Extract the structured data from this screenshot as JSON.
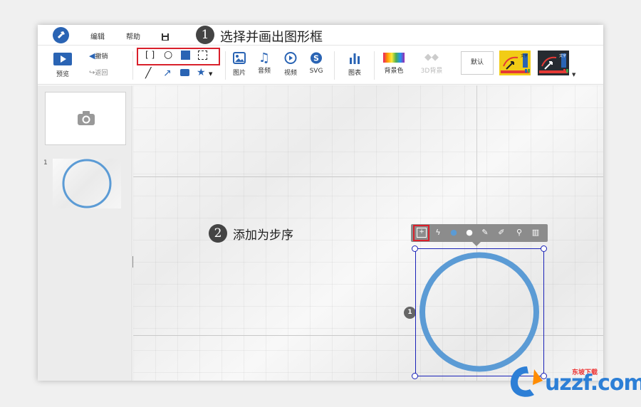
{
  "menubar": {
    "edit": "编辑",
    "help": "帮助"
  },
  "annotations": {
    "step1_num": "1",
    "step1_text": "选择并画出图形框",
    "step2_num": "2",
    "step2_text": "添加为步序"
  },
  "toolbar": {
    "preview": "预览",
    "undo": "撤销",
    "redo": "返回",
    "image": "图片",
    "audio": "音频",
    "video": "视频",
    "svg": "SVG",
    "chart": "图表",
    "background": "背景色",
    "bg3d": "3D背景",
    "default": "默认",
    "theme_text": "文字"
  },
  "slides": {
    "number": "1"
  },
  "canvas": {
    "step_marker": "1"
  },
  "watermark": {
    "brand": "uzzf.com",
    "sub": "东坡下载"
  },
  "colors": {
    "accent_red": "#d9202b",
    "selection_blue": "#1a22b8",
    "circle_blue": "#5b9bd5",
    "brand_blue": "#2d7fd6"
  }
}
